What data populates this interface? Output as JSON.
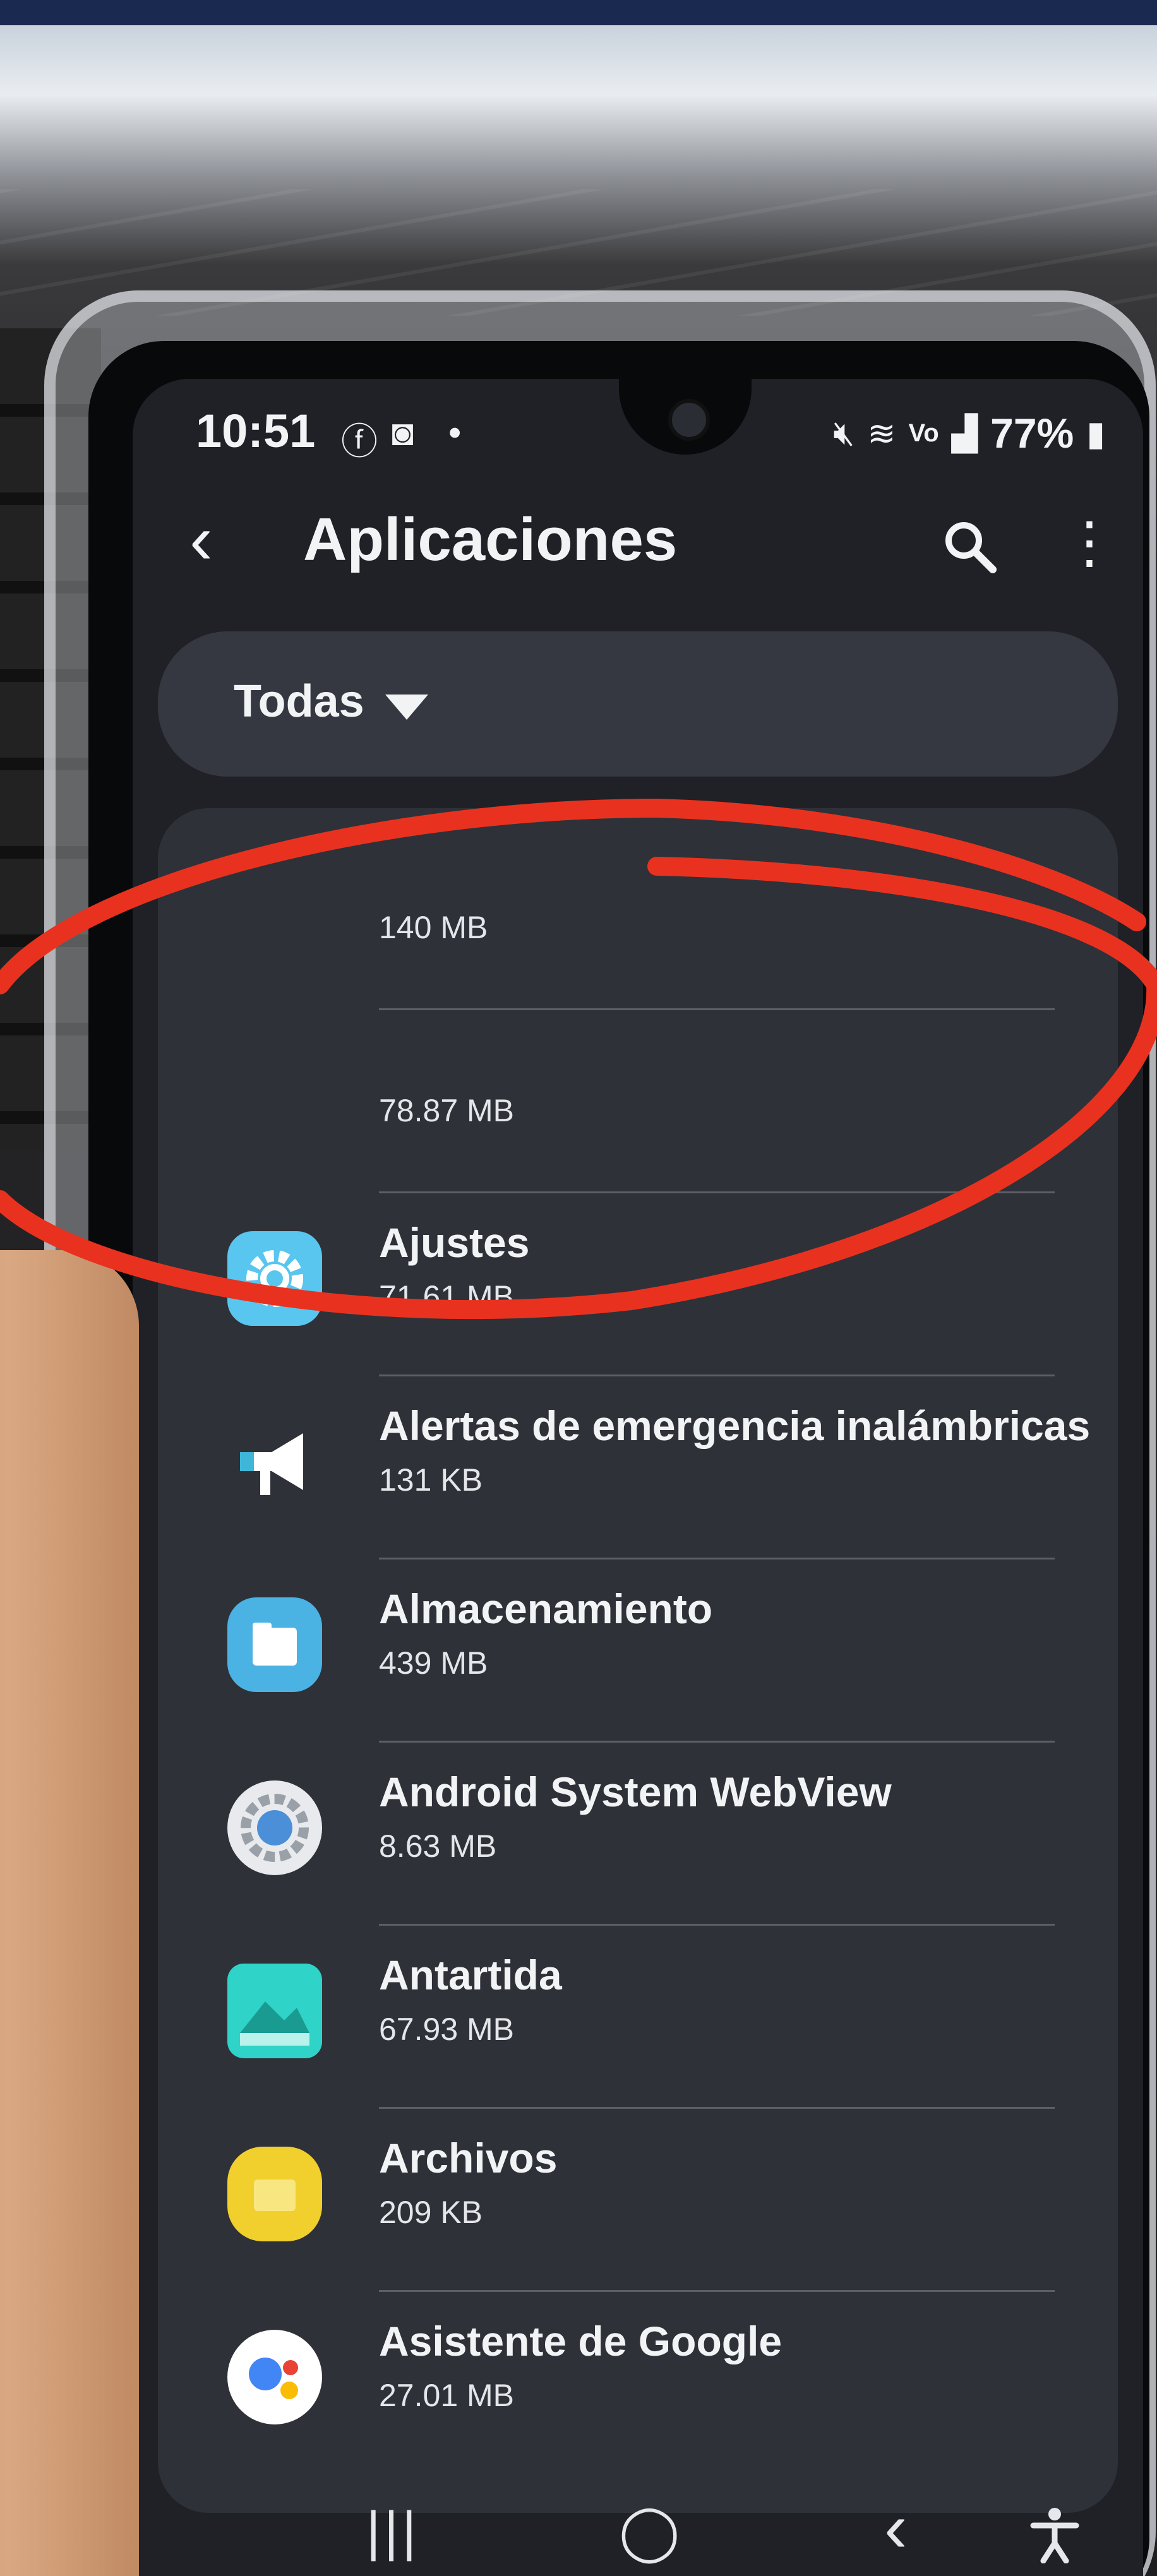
{
  "status_bar": {
    "time": "10:51",
    "battery": "77%",
    "left_icons": [
      "facebook-icon",
      "instagram-icon",
      "dot-icon"
    ],
    "right_icons": [
      "mute-icon",
      "wifi-icon",
      "volte-icon",
      "signal-icon",
      "battery-icon"
    ]
  },
  "toolbar": {
    "title": "Aplicaciones"
  },
  "filter": {
    "selected": "Todas"
  },
  "apps": [
    {
      "name": "",
      "size": "140 MB",
      "icon": "hidden",
      "color": "#2e3138"
    },
    {
      "name": "",
      "size": "78.87 MB",
      "icon": "hidden",
      "color": "#2e3138"
    },
    {
      "name": "Ajustes",
      "size": "71.61 MB",
      "icon": "gear-icon",
      "color": "#58c6ee"
    },
    {
      "name": "Alertas de emergencia inalámbricas",
      "size": "131 KB",
      "icon": "megaphone-icon",
      "color": "#ffffff"
    },
    {
      "name": "Almacenamiento",
      "size": "439 MB",
      "icon": "folder-icon",
      "color": "#4bb2e4"
    },
    {
      "name": "Android System WebView",
      "size": "8.63 MB",
      "icon": "webview-gear-icon",
      "color": "#4a8fd8"
    },
    {
      "name": "Antartida",
      "size": "67.93 MB",
      "icon": "landscape-icon",
      "color": "#2fd3c8"
    },
    {
      "name": "Archivos",
      "size": "209 KB",
      "icon": "yellow-folder-icon",
      "color": "#f1cf2d"
    },
    {
      "name": "Asistente de Google",
      "size": "27.01 MB",
      "icon": "assistant-icon",
      "color": "#ffffff"
    }
  ],
  "nav": {
    "recents": "|||",
    "home": "◯",
    "back": "‹",
    "accessibility": "accessibility-icon"
  },
  "annotation_color": "#e8321f"
}
